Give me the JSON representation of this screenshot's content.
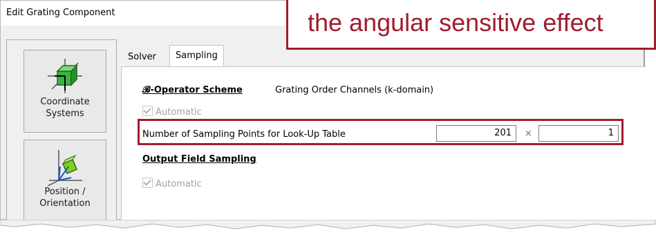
{
  "window": {
    "title": "Edit Grating Component"
  },
  "sidebar": {
    "items": [
      {
        "label1": "Coordinate",
        "label2": "Systems"
      },
      {
        "label1": "Position /",
        "label2": "Orientation"
      }
    ]
  },
  "tabs": [
    {
      "label": "Solver"
    },
    {
      "label": "Sampling"
    }
  ],
  "sampling": {
    "operator_heading": "𝓑-Operator Scheme",
    "operator_value": "Grating Order Channels (k-domain)",
    "automatic_label_1": "Automatic",
    "points_label": "Number of Sampling Points for Look-Up Table",
    "points_x": "201",
    "times_symbol": "×",
    "points_y": "1",
    "output_heading": "Output Field Sampling",
    "automatic_label_2": "Automatic"
  },
  "callout": {
    "text": "the angular sensitive effect"
  },
  "colors": {
    "highlight": "#a01c2e",
    "panel_bg": "#f0f0f0"
  }
}
